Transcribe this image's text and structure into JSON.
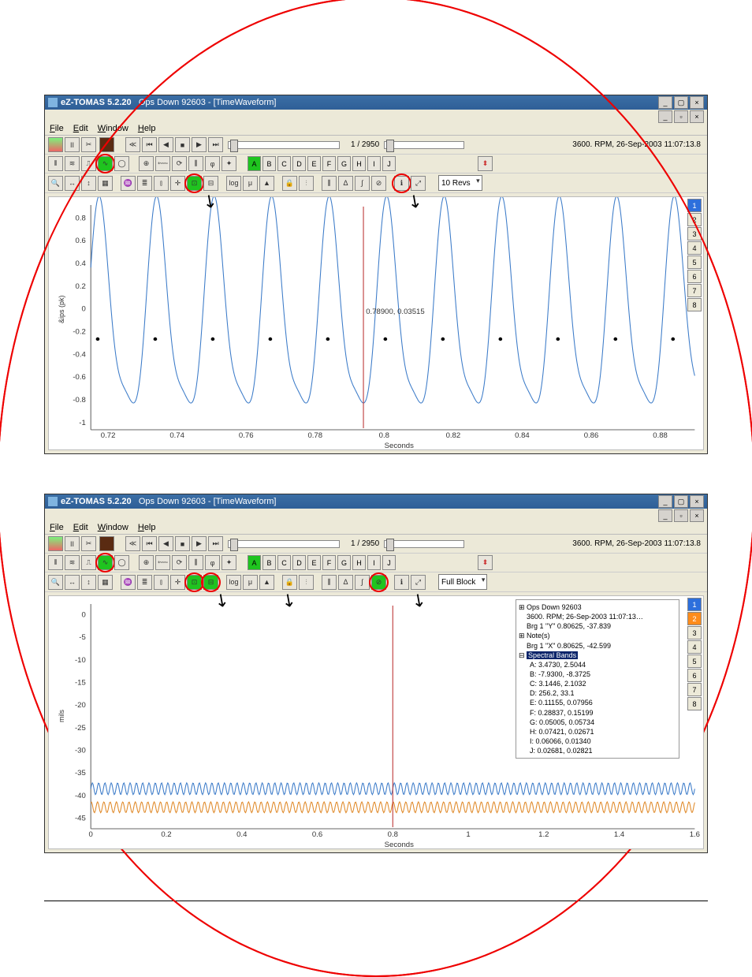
{
  "app_title_prefix": "eZ-TOMAS 5.2.20",
  "doc_title": "Ops Down 92603 - [TimeWaveform]",
  "menu": {
    "file": "File",
    "edit": "Edit",
    "window": "Window",
    "help": "Help"
  },
  "pos_label": "1 / 2950",
  "status": "3600. RPM,   26-Sep-2003 11:07:13.8",
  "letters": [
    "A",
    "B",
    "C",
    "D",
    "E",
    "F",
    "G",
    "H",
    "I",
    "J"
  ],
  "revs_select": "10 Revs",
  "block_select": "Full Block",
  "channels": [
    "1",
    "2",
    "3",
    "4",
    "5",
    "6",
    "7",
    "8"
  ],
  "panel1": {
    "cursor_label": "0.78900, 0.03515",
    "y_axis_label": "&ips (pk)",
    "x_axis_label": "Seconds",
    "x_ticks": [
      "0.72",
      "0.74",
      "0.76",
      "0.78",
      "0.8",
      "0.82",
      "0.84",
      "0.86",
      "0.88"
    ],
    "y_ticks": [
      "0.8",
      "0.6",
      "0.4",
      "0.2",
      "0",
      "-0.2",
      "-0.4",
      "-0.6",
      "-0.8",
      "-1"
    ]
  },
  "panel2": {
    "y_axis_label": "mils",
    "x_axis_label": "Seconds",
    "x_ticks": [
      "0",
      "0.2",
      "0.4",
      "0.6",
      "0.8",
      "1",
      "1.2",
      "1.4",
      "1.6"
    ],
    "y_ticks": [
      "0",
      "-5",
      "-10",
      "-15",
      "-20",
      "-25",
      "-30",
      "-35",
      "-40",
      "-45"
    ],
    "legend": {
      "root": "Ops Down 92603",
      "rpm_line": "3600. RPM;  26-Sep-2003 11:07:13…",
      "brg_y": "Brg 1 \"Y\"   0.80625, -37.839",
      "notes": "Note(s)",
      "brg_x": "Brg 1 \"X\"  0.80625, -42.599",
      "sb_label": "Spectral Bands",
      "bands": [
        "A:  3.4730, 2.5044",
        "B:  -7.9300, -8.3725",
        "C:  3.1446, 2.1032",
        "D:  256.2, 33.1",
        "E:  0.11155, 0.07956",
        "F:  0.28837, 0.15199",
        "G:  0.05005, 0.05734",
        "H:  0.07421, 0.02671",
        "I:   0.06066, 0.01340",
        "J:  0.02681, 0.02821"
      ]
    }
  },
  "chart_data": [
    {
      "type": "line",
      "title": "TimeWaveform",
      "xlabel": "Seconds",
      "ylabel": "&ips (pk)",
      "xlim": [
        0.715,
        0.89
      ],
      "ylim": [
        -1.05,
        0.9
      ],
      "cursor": {
        "x": 0.789,
        "y": 0.03515
      },
      "series": [
        {
          "name": "Brg 1",
          "period_s": 0.01667,
          "cycles": 10,
          "peak": 0.78,
          "trough": -0.98
        }
      ]
    },
    {
      "type": "line",
      "title": "TimeWaveform",
      "xlabel": "Seconds",
      "ylabel": "mils",
      "xlim": [
        0,
        1.6
      ],
      "ylim": [
        -47,
        2
      ],
      "cursor": {
        "x": 0.806
      },
      "series": [
        {
          "name": "Brg 1 Y",
          "baseline": -38.5,
          "amplitude": 1.3,
          "frequency_hz": 60
        },
        {
          "name": "Brg 1 X",
          "baseline": -42.6,
          "amplitude": 1.2,
          "frequency_hz": 60
        }
      ]
    }
  ]
}
